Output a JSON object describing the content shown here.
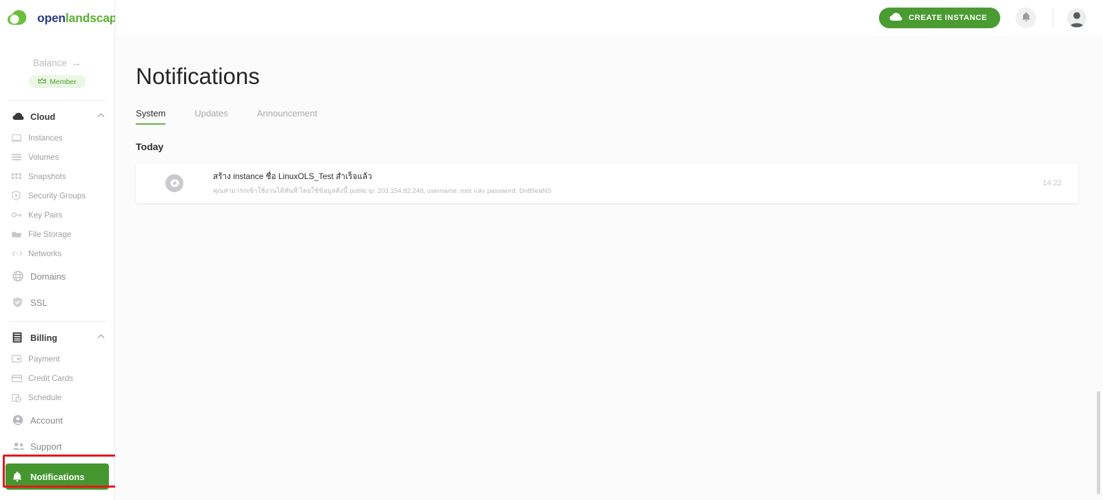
{
  "brand": {
    "logo_open": "open",
    "logo_landscape": "landscape",
    "logo_icon": "cloud-leaf-logo",
    "green": "#5bb032",
    "blue": "#2a3b8f"
  },
  "sidebar": {
    "balance_label": "Balance",
    "balance_arrow": "→",
    "member_badge": "Member",
    "groups": [
      {
        "label": "Cloud",
        "icon": "cloud-icon",
        "expanded": true,
        "items": [
          {
            "label": "Instances",
            "icon": "monitor-icon"
          },
          {
            "label": "Volumes",
            "icon": "volumes-icon"
          },
          {
            "label": "Snapshots",
            "icon": "snapshots-grid-icon"
          },
          {
            "label": "Security Groups",
            "icon": "shield-icon"
          },
          {
            "label": "Key Pairs",
            "icon": "key-icon"
          },
          {
            "label": "File Storage",
            "icon": "folder-icon"
          },
          {
            "label": "Networks",
            "icon": "code-brackets-icon"
          }
        ]
      }
    ],
    "domains": {
      "label": "Domains",
      "icon": "globe-icon"
    },
    "ssl": {
      "label": "SSL",
      "icon": "shield-check-icon"
    },
    "billing": {
      "label": "Billing",
      "icon": "billing-list-icon",
      "expanded": true,
      "items": [
        {
          "label": "Payment",
          "icon": "wallet-icon"
        },
        {
          "label": "Credit Cards",
          "icon": "credit-card-icon"
        },
        {
          "label": "Schedule",
          "icon": "schedule-clock-icon"
        }
      ]
    },
    "account": {
      "label": "Account",
      "icon": "user-circle-icon"
    },
    "support": {
      "label": "Support",
      "icon": "people-icon"
    },
    "notifications": {
      "label": "Notifications",
      "icon": "bell-icon",
      "active": true,
      "active_color": "#45962f"
    }
  },
  "topbar": {
    "create_instance_label": "CREATE INSTANCE",
    "create_instance_icon": "cloud-icon",
    "create_instance_color": "#4a9c32",
    "bell_icon": "bell-icon",
    "avatar_icon": "user-avatar"
  },
  "page": {
    "title": "Notifications",
    "tabs": [
      {
        "label": "System",
        "active": true
      },
      {
        "label": "Updates",
        "active": false
      },
      {
        "label": "Announcement",
        "active": false
      }
    ],
    "section_label": "Today",
    "notifications": [
      {
        "icon": "gear-icon",
        "title": "สร้าง instance ชื่อ LinuxOLS_Test สำเร็จแล้ว",
        "description": "คุณสามารถเข้าใช้งานได้ทันที โดยใช้ข้อมูลดังนี้ public ip: 203.154.82.248, username: root และ password: Dn89eaNS",
        "time": "14:22"
      }
    ]
  }
}
